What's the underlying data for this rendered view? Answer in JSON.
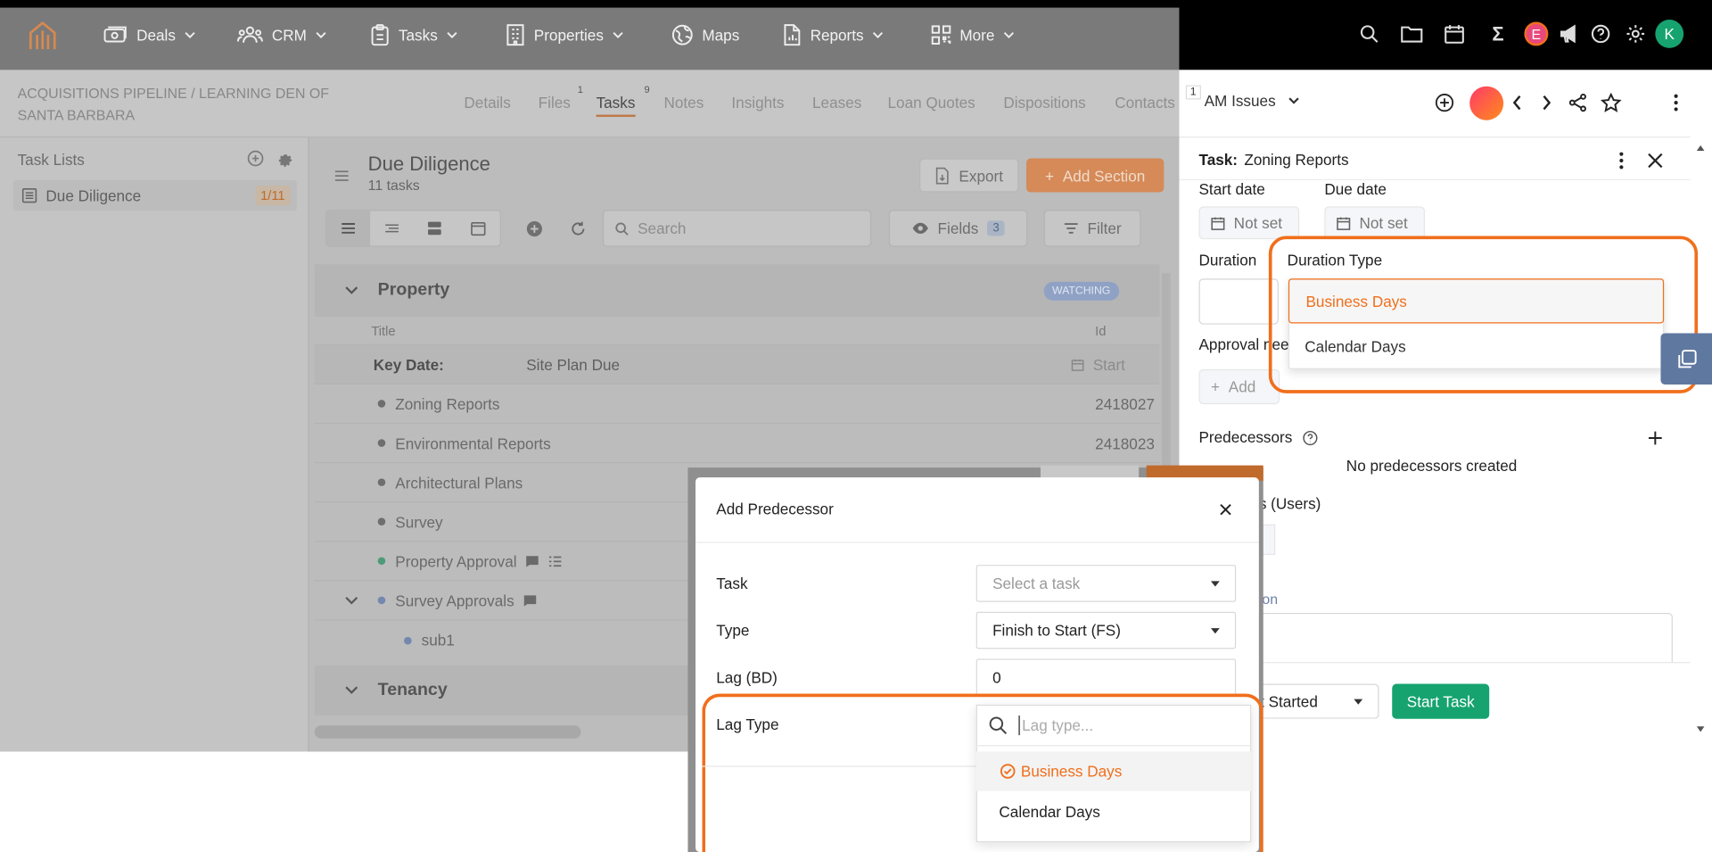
{
  "nav": {
    "items": [
      {
        "label": "Deals",
        "icon": "money-icon"
      },
      {
        "label": "CRM",
        "icon": "users-icon"
      },
      {
        "label": "Tasks",
        "icon": "clipboard-icon"
      },
      {
        "label": "Properties",
        "icon": "building-icon"
      },
      {
        "label": "Maps",
        "icon": "globe-icon"
      },
      {
        "label": "Reports",
        "icon": "report-icon"
      },
      {
        "label": "More",
        "icon": "grid-icon"
      }
    ],
    "avatar_e": "E",
    "avatar_k": "K"
  },
  "header": {
    "breadcrumb": "ACQUISITIONS PIPELINE / LEARNING DEN OF SANTA BARBARA",
    "tabs": [
      "Details",
      "Files",
      "Tasks",
      "Notes",
      "Insights",
      "Leases",
      "Loan Quotes",
      "Dispositions",
      "Contacts"
    ],
    "files_count": "1",
    "tasks_count": "9",
    "panel_count": "1"
  },
  "sidebar": {
    "title": "Task Lists",
    "items": [
      {
        "label": "Due Diligence",
        "count": "1/11"
      }
    ]
  },
  "main": {
    "title": "Due Diligence",
    "subtitle": "11 tasks",
    "export_label": "Export",
    "add_section_label": "Add Section",
    "search_placeholder": "Search",
    "fields_label": "Fields",
    "fields_count": "3",
    "filter_label": "Filter",
    "section1": {
      "name": "Property",
      "badge": "WATCHING"
    },
    "columns": {
      "title": "Title",
      "id": "Id"
    },
    "key_date": {
      "label": "Key Date:",
      "value": "Site Plan Due",
      "start": "Start"
    },
    "tasks": [
      {
        "title": "Zoning Reports",
        "id": "2418027"
      },
      {
        "title": "Environmental Reports",
        "id": "2418023"
      },
      {
        "title": "Architectural Plans",
        "id": ""
      },
      {
        "title": "Survey",
        "id": ""
      },
      {
        "title": "Property Approval",
        "id": ""
      },
      {
        "title": "Survey Approvals",
        "id": ""
      }
    ],
    "subtask": "sub1",
    "section2": {
      "name": "Tenancy"
    }
  },
  "panel": {
    "title": "AM Issues",
    "task_label": "Task:",
    "task_name": "Zoning Reports",
    "start_date_label": "Start date",
    "due_date_label": "Due date",
    "not_set": "Not set",
    "duration_label": "Duration",
    "duration_type_label": "Duration Type",
    "duration_options": [
      "Business Days",
      "Calendar Days"
    ],
    "approval_label": "Approval nee",
    "add_label": "Add",
    "predecessors_label": "Predecessors",
    "no_predecessors": "No predecessors created",
    "users_label": "s (Users)",
    "description_fragment": "ion",
    "status_fragment": "t Started",
    "start_task_label": "Start Task"
  },
  "modal": {
    "title": "Add Predecessor",
    "task_label": "Task",
    "task_placeholder": "Select a task",
    "type_label": "Type",
    "type_value": "Finish to Start (FS)",
    "lag_label": "Lag (BD)",
    "lag_value": "0",
    "lag_type_label": "Lag Type",
    "lag_type_placeholder": "Lag type...",
    "lag_options": [
      "Business Days",
      "Calendar Days"
    ]
  },
  "colors": {
    "accent": "#f06f1c",
    "green": "#16a36f",
    "blue_badge": "#6f8fd0"
  }
}
